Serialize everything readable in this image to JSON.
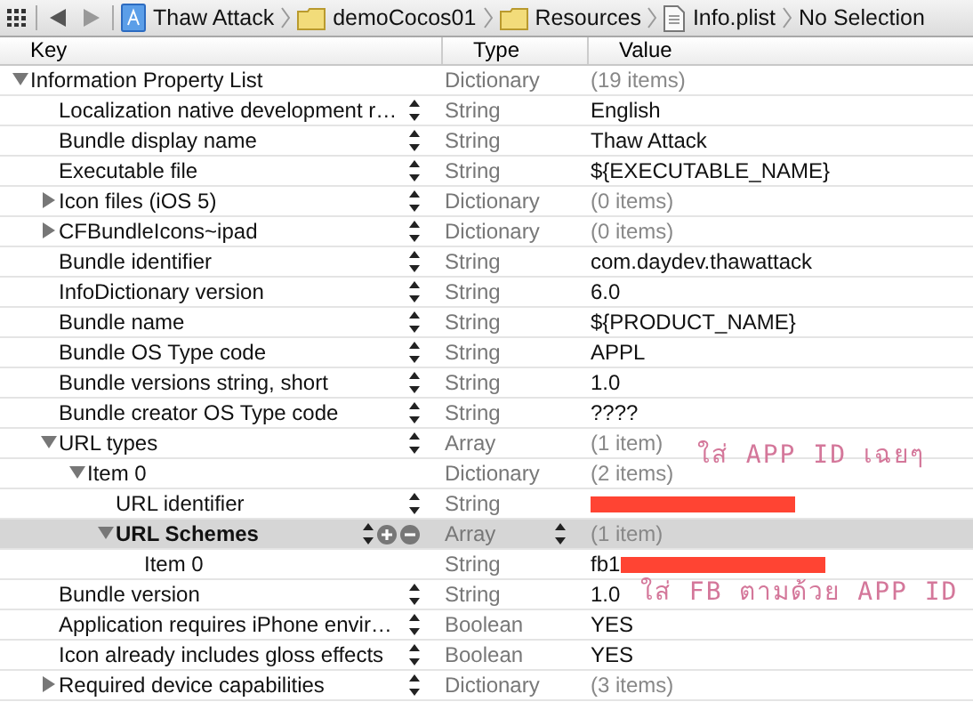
{
  "breadcrumbs": [
    {
      "label": "Thaw Attack",
      "kind": "project"
    },
    {
      "label": "demoCocos01",
      "kind": "folder"
    },
    {
      "label": "Resources",
      "kind": "folder"
    },
    {
      "label": "Info.plist",
      "kind": "file"
    },
    {
      "label": "No Selection",
      "kind": "none"
    }
  ],
  "columns": [
    "Key",
    "Type",
    "Value"
  ],
  "rows": [
    {
      "key": "Information Property List",
      "type": "Dictionary",
      "value": "(19 items)",
      "expanded": true,
      "stepper": false,
      "selected": false,
      "children": [
        {
          "key": "Localization native development r…",
          "type": "String",
          "value": "English",
          "stepper": true,
          "selected": false
        },
        {
          "key": "Bundle display name",
          "type": "String",
          "value": "Thaw Attack",
          "stepper": true,
          "selected": false
        },
        {
          "key": "Executable file",
          "type": "String",
          "value": "${EXECUTABLE_NAME}",
          "stepper": true,
          "selected": false
        },
        {
          "key": "Icon files (iOS 5)",
          "type": "Dictionary",
          "value": "(0 items)",
          "expanded": false,
          "stepper": true,
          "selected": false
        },
        {
          "key": "CFBundleIcons~ipad",
          "type": "Dictionary",
          "value": "(0 items)",
          "expanded": false,
          "stepper": true,
          "selected": false
        },
        {
          "key": "Bundle identifier",
          "type": "String",
          "value": "com.daydev.thawattack",
          "stepper": true,
          "selected": false
        },
        {
          "key": "InfoDictionary version",
          "type": "String",
          "value": "6.0",
          "stepper": true,
          "selected": false
        },
        {
          "key": "Bundle name",
          "type": "String",
          "value": "${PRODUCT_NAME}",
          "stepper": true,
          "selected": false
        },
        {
          "key": "Bundle OS Type code",
          "type": "String",
          "value": "APPL",
          "stepper": true,
          "selected": false
        },
        {
          "key": "Bundle versions string, short",
          "type": "String",
          "value": "1.0",
          "stepper": true,
          "selected": false
        },
        {
          "key": "Bundle creator OS Type code",
          "type": "String",
          "value": "????",
          "stepper": true,
          "selected": false
        },
        {
          "key": "URL types",
          "type": "Array",
          "value": "(1 item)",
          "expanded": true,
          "stepper": true,
          "selected": false,
          "children": [
            {
              "key": "Item 0",
              "type": "Dictionary",
              "value": "(2 items)",
              "expanded": true,
              "stepper": false,
              "selected": false,
              "children": [
                {
                  "key": "URL identifier",
                  "type": "String",
                  "redacted": true,
                  "stepper": true,
                  "selected": false
                },
                {
                  "key": "URL Schemes",
                  "type": "Array",
                  "value": "(1 item)",
                  "expanded": true,
                  "stepper": true,
                  "selected": true,
                  "children": [
                    {
                      "key": "Item 0",
                      "type": "String",
                      "value": "fb1",
                      "redacted": true,
                      "stepper": false,
                      "selected": false
                    }
                  ]
                }
              ]
            }
          ]
        },
        {
          "key": "Bundle version",
          "type": "String",
          "value": "1.0",
          "stepper": true,
          "selected": false
        },
        {
          "key": "Application requires iPhone envir…",
          "type": "Boolean",
          "value": "YES",
          "stepper": true,
          "selected": false
        },
        {
          "key": "Icon already includes gloss effects",
          "type": "Boolean",
          "value": "YES",
          "stepper": true,
          "selected": false
        },
        {
          "key": "Required device capabilities",
          "type": "Dictionary",
          "value": "(3 items)",
          "expanded": false,
          "stepper": true,
          "selected": false
        }
      ]
    }
  ],
  "annotations": [
    "ใส่ APP ID เฉยๆ",
    "ใส่ FB ตามด้วย APP ID"
  ]
}
